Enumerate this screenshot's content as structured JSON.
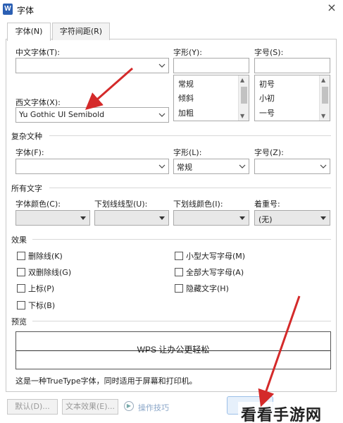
{
  "window": {
    "app_icon": "W",
    "title": "字体",
    "close": "×"
  },
  "tabs": [
    {
      "label": "字体(N)",
      "active": true
    },
    {
      "label": "字符间距(R)",
      "active": false
    }
  ],
  "font": {
    "cn_font_label": "中文字体(T):",
    "cn_font_value": "",
    "style_label": "字形(Y):",
    "size_label": "字号(S):",
    "style_input": "",
    "size_input": "",
    "style_options": [
      "常规",
      "倾斜",
      "加粗"
    ],
    "size_options": [
      "初号",
      "小初",
      "一号"
    ],
    "west_font_label": "西文字体(X):",
    "west_font_value": "Yu Gothic UI Semibold"
  },
  "complex": {
    "section": "复杂文种",
    "font_label": "字体(F):",
    "font_value": "",
    "style_label": "字形(L):",
    "style_value": "常规",
    "size_label": "字号(Z):",
    "size_value": ""
  },
  "all_text": {
    "section": "所有文字",
    "font_color_label": "字体颜色(C):",
    "underline_style_label": "下划线线型(U):",
    "underline_color_label": "下划线颜色(I):",
    "emphasis_label": "着重号:",
    "emphasis_value": "(无)"
  },
  "effects": {
    "section": "效果",
    "left": [
      "删除线(K)",
      "双删除线(G)",
      "上标(P)",
      "下标(B)"
    ],
    "right": [
      "小型大写字母(M)",
      "全部大写字母(A)",
      "隐藏文字(H)"
    ]
  },
  "preview": {
    "section": "预览",
    "sample": "WPS 让办公更轻松",
    "note": "这是一种TrueType字体，同时适用于屏幕和打印机。"
  },
  "buttons": {
    "default": "默认(D)...",
    "text_effect": "文本效果(E)...",
    "tips": "操作技巧"
  },
  "watermark": "看看手游网",
  "colors": {
    "arrow": "#d42a2a",
    "accent": "#2b5fb3"
  }
}
